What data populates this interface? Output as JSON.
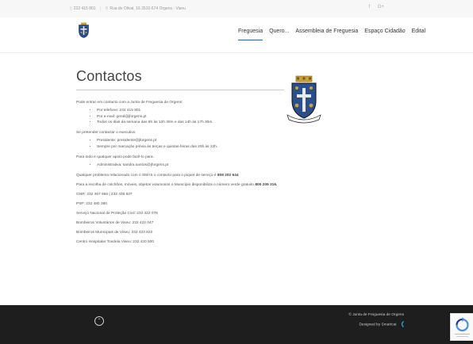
{
  "topbar": {
    "phone_icon": "phone-icon",
    "phone": "232 415 801",
    "location_icon": "map-marker-icon",
    "address": "Rua do Olival, 16 3510-674 Orgens - Viseu",
    "social": [
      "f",
      "G+"
    ]
  },
  "nav": {
    "items": [
      "Freguesia",
      "Quero...",
      "Assembleia de Freguesia",
      "Espaço Cidadão",
      "Edital"
    ],
    "active_color": "#2b5fa8"
  },
  "page": {
    "title": "Contactos",
    "intro": "Pode entrar em contacto com a Junta de Freguesia de Orgens:",
    "contact_list": [
      "Por telefone: 232 415 801",
      "Por e-mail: geral@jforgens.pt",
      "Todos os dias da semana das 9h às 12h 30m e das 14h às 17h 30m."
    ],
    "exec_intro": "Se pretender contactar o executivo",
    "exec_list": [
      "Presidente: presidente@jforgens.pt",
      "Sempre por marcação prévia às terças e quintas-feiras das 20h às 22h."
    ],
    "support_intro": "Para todo e qualquer apoio pode fazê-lo para:",
    "support_list": [
      "Administrativa: sandra.santos@jforgens.pt"
    ],
    "smas_prefix": "Qualquer problema relacionado com o SMAS o contacto para o piquet de serviço é ",
    "smas_number": "808 202 644",
    "recolha_prefix": "Para a recolha de colchões, móveis, objetos volumosos o Município disponibiliza o número verde gratuito ",
    "recolha_number": "800 209 316.",
    "other_contacts": [
      "GNR: 232 467 956 | 232 436 637",
      "PSP: 232 480 380",
      "Serviço Nacional de Proteção Civil: 232 422 076",
      "Bombeiros Voluntários de Viseu: 232 422 047",
      "Bombeiros Municipais de Viseu: 232 423 822",
      "Centro Hospitalar Tondela Viseu: 232 420 500"
    ]
  },
  "footer": {
    "copyright": "© Junta de Freguesia de Orgens",
    "designed_by": "Designed by Smartcat",
    "scroll_top_icon": "chevron-up-icon",
    "background": "#1e1e1e"
  }
}
